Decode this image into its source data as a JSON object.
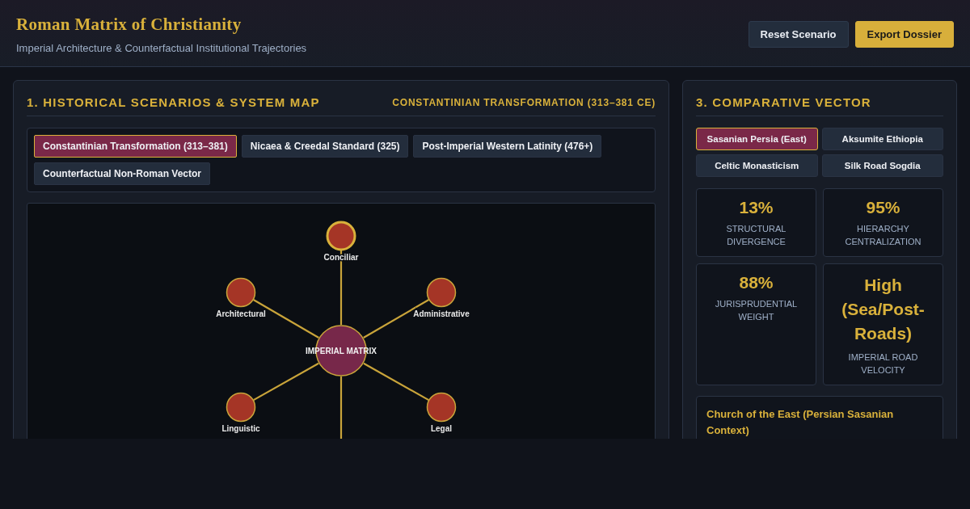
{
  "header": {
    "title": "Roman Matrix of Christianity",
    "subtitle": "Imperial Architecture & Counterfactual Institutional Trajectories",
    "buttons": [
      {
        "label": "Reset Scenario",
        "kind": "secondary"
      },
      {
        "label": "Export Dossier",
        "kind": "primary"
      }
    ]
  },
  "scenarios": {
    "title": "1. HISTORICAL SCENARIOS & SYSTEM MAP",
    "current": "CONSTANTINIAN TRANSFORMATION (313–381 CE)",
    "tabs": [
      {
        "label": "Constantinian Transformation (313–381)",
        "selected": true
      },
      {
        "label": "Nicaea & Creedal Standard (325)",
        "selected": false
      },
      {
        "label": "Post-Imperial Western Latinity (476+)",
        "selected": false
      },
      {
        "label": "Counterfactual Non-Roman Vector",
        "selected": false
      }
    ],
    "map": {
      "center": "IMPERIAL MATRIX",
      "nodes": [
        {
          "label": "Conciliar",
          "highlighted": true
        },
        {
          "label": "Administrative",
          "highlighted": false
        },
        {
          "label": "Legal",
          "highlighted": false
        },
        {
          "label": "Linguistic",
          "highlighted": false
        },
        {
          "label": "Architectural",
          "highlighted": false
        }
      ]
    }
  },
  "comparative": {
    "title": "3. COMPARATIVE VECTOR",
    "options": [
      {
        "label": "Sasanian Persia (East)",
        "selected": true
      },
      {
        "label": "Aksumite Ethiopia",
        "selected": false
      },
      {
        "label": "Celtic Monasticism",
        "selected": false
      },
      {
        "label": "Silk Road Sogdia",
        "selected": false
      }
    ],
    "metrics": [
      {
        "value": "13%",
        "label": "STRUCTURAL DIVERGENCE"
      },
      {
        "value": "95%",
        "label": "HIERARCHY CENTRALIZATION"
      },
      {
        "value": "88%",
        "label": "JURISPRUDENTIAL WEIGHT"
      },
      {
        "value": "High (Sea/Post-Roads)",
        "label": "IMPERIAL ROAD VELOCITY"
      }
    ],
    "note": {
      "title": "Church of the East (Persian Sasanian Context)"
    }
  }
}
